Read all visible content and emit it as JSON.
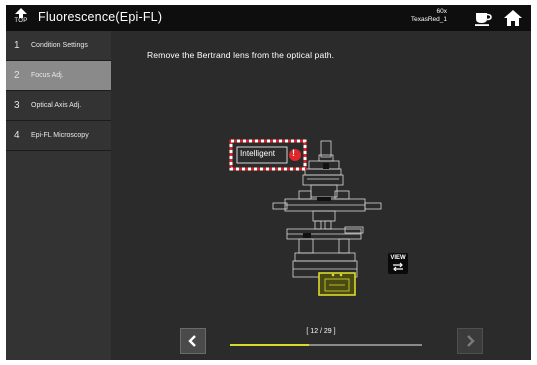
{
  "header": {
    "top_label": "TOP",
    "title": "Fluorescence(Epi-FL)",
    "magnification": "60x",
    "filter": "TexasRed_1"
  },
  "sidebar": {
    "items": [
      {
        "num": "1",
        "label": "Condition Settings",
        "active": false
      },
      {
        "num": "2",
        "label": "Focus Adj.",
        "active": true
      },
      {
        "num": "3",
        "label": "Optical Axis Adj.",
        "active": false
      },
      {
        "num": "4",
        "label": "Epi-FL Microscopy",
        "active": false
      }
    ]
  },
  "main": {
    "instruction": "Remove the Bertrand lens from the optical path.",
    "intelligent_label": "Intelligent",
    "view_label": "VIEW"
  },
  "pagination": {
    "text": "[ 12 / 29 ]",
    "current": 12,
    "total": 29
  },
  "colors": {
    "highlight": "#dada2a",
    "alert": "#e0262a",
    "active_item": "#8a8a8a"
  },
  "icons": [
    "top-arrow-icon",
    "cup-icon",
    "home-icon",
    "swap-icon",
    "chevron-left-icon",
    "chevron-right-icon",
    "exclamation-icon"
  ]
}
